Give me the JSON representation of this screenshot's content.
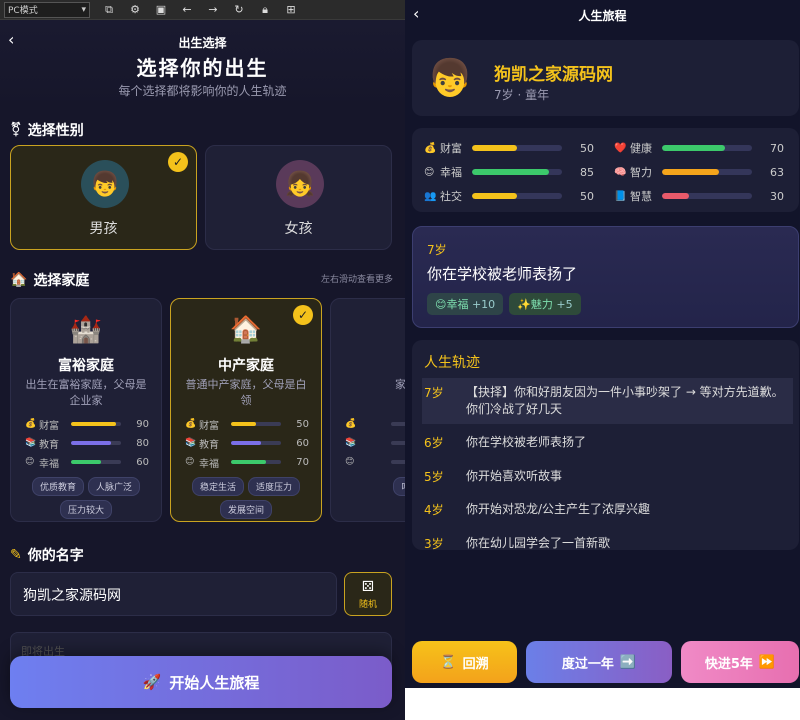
{
  "toolbar": {
    "mode": "PC模式",
    "icons": [
      "external-link-icon",
      "gear-icon",
      "terminal-icon",
      "arrow-left-icon",
      "arrow-right-icon",
      "refresh-icon",
      "lock-icon",
      "qrcode-icon"
    ]
  },
  "birth": {
    "header_sub": "出生选择",
    "title": "选择你的出生",
    "desc": "每个选择都将影响你的人生轨迹",
    "gender_title": "选择性别",
    "genders": [
      {
        "label": "男孩",
        "emoji": "👦"
      },
      {
        "label": "女孩",
        "emoji": "👧"
      }
    ],
    "family_title": "选择家庭",
    "family_hint": "左右滑动查看更多",
    "families": [
      {
        "icon": "🏰",
        "name": "富裕家庭",
        "desc": "出生在富裕家庭，父母是企业家",
        "stats": [
          {
            "name": "财富",
            "value": 90,
            "color": "#f4c21b",
            "icon": "💰"
          },
          {
            "name": "教育",
            "value": 80,
            "color": "#7b6fe8",
            "icon": "📚"
          },
          {
            "name": "幸福",
            "value": 60,
            "color": "#3cc96b",
            "icon": "😊"
          }
        ],
        "tags": [
          "优质教育",
          "人脉广泛",
          "压力较大"
        ]
      },
      {
        "icon": "🏠",
        "name": "中产家庭",
        "desc": "普通中产家庭，父母是白领",
        "stats": [
          {
            "name": "财富",
            "value": 50,
            "color": "#f4c21b",
            "icon": "💰"
          },
          {
            "name": "教育",
            "value": 60,
            "color": "#7b6fe8",
            "icon": "📚"
          },
          {
            "name": "幸福",
            "value": 70,
            "color": "#3cc96b",
            "icon": "😊"
          }
        ],
        "tags": [
          "稳定生活",
          "适度压力",
          "发展空间"
        ]
      },
      {
        "icon": "",
        "name": "",
        "desc": "家境",
        "stats": [
          {
            "name": "",
            "value": 0,
            "color": "#f4c21b",
            "icon": "💰"
          },
          {
            "name": "",
            "value": 0,
            "color": "#7b6fe8",
            "icon": "📚"
          },
          {
            "name": "",
            "value": 0,
            "color": "#3cc96b",
            "icon": "😊"
          }
        ],
        "tags": [
          "吃"
        ]
      }
    ],
    "name_title": "你的名字",
    "name_value": "狗凯之家源码网",
    "random_label": "随机",
    "ghost_placeholder": "即将出生",
    "start_label": "开始人生旅程"
  },
  "journey": {
    "title": "人生旅程",
    "name": "狗凯之家源码网",
    "age_stage": "7岁 · 童年",
    "stats": [
      {
        "name": "财富",
        "value": 50,
        "color": "#f4c21b",
        "icon": "💰"
      },
      {
        "name": "健康",
        "value": 70,
        "color": "#3cc96b",
        "icon": "❤️"
      },
      {
        "name": "幸福",
        "value": 85,
        "color": "#3cc96b",
        "icon": "😊"
      },
      {
        "name": "智力",
        "value": 63,
        "color": "#f4a41b",
        "icon": "🧠"
      },
      {
        "name": "社交",
        "value": 50,
        "color": "#f4c21b",
        "icon": "👥"
      },
      {
        "name": "智慧",
        "value": 30,
        "color": "#e85a6a",
        "icon": "📘"
      }
    ],
    "event": {
      "age": "7岁",
      "text": "你在学校被老师表扬了",
      "effects": [
        {
          "icon": "😊",
          "label": "幸福",
          "delta": "+10"
        },
        {
          "icon": "✨",
          "label": "魅力",
          "delta": "+5"
        }
      ]
    },
    "trajectory_title": "人生轨迹",
    "trajectory": [
      {
        "age": "7岁",
        "text": "【抉择】你和好朋友因为一件小事吵架了 → 等对方先道歉。你们冷战了好几天"
      },
      {
        "age": "6岁",
        "text": "你在学校被老师表扬了"
      },
      {
        "age": "5岁",
        "text": "你开始喜欢听故事"
      },
      {
        "age": "4岁",
        "text": "你开始对恐龙/公主产生了浓厚兴趣"
      },
      {
        "age": "3岁",
        "text": "你在幼儿园学会了一首新歌"
      }
    ],
    "buttons": [
      {
        "label": "回溯",
        "icon": "⏳"
      },
      {
        "label": "度过一年",
        "icon": "➡️"
      },
      {
        "label": "快进5年",
        "icon": "⏩"
      }
    ]
  }
}
